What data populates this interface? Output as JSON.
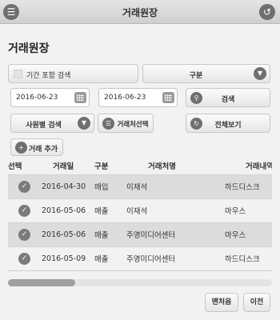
{
  "topbar": {
    "title": "거래원장",
    "menu_icon": "menu-icon",
    "back_icon": "refresh-back-icon"
  },
  "page_title": "거래원장",
  "filters": {
    "period_search_label": "기간 포함 검색",
    "type_select_value": "구분",
    "date_from": "2016-06-23",
    "date_to": "2016-06-23",
    "search_label": "검색",
    "employee_select_value": "사원별 검색",
    "client_select_label": "거래처선택",
    "view_all_label": "전체보기",
    "add_label": "거래 추가"
  },
  "table": {
    "columns": [
      "선택",
      "거래일",
      "구분",
      "거래처명",
      "거래내역"
    ],
    "rows": [
      {
        "date": "2016-04-30",
        "type": "매입",
        "client": "이재석",
        "detail": "하드디스크"
      },
      {
        "date": "2016-05-06",
        "type": "매출",
        "client": "이재석",
        "detail": "마우스"
      },
      {
        "date": "2016-05-06",
        "type": "매출",
        "client": "주영미디어센터",
        "detail": "마우스"
      },
      {
        "date": "2016-05-09",
        "type": "매출",
        "client": "주영미디어센터",
        "detail": "하드디스크"
      }
    ]
  },
  "pagination": {
    "first_label": "맨처음",
    "prev_label": "이전"
  }
}
